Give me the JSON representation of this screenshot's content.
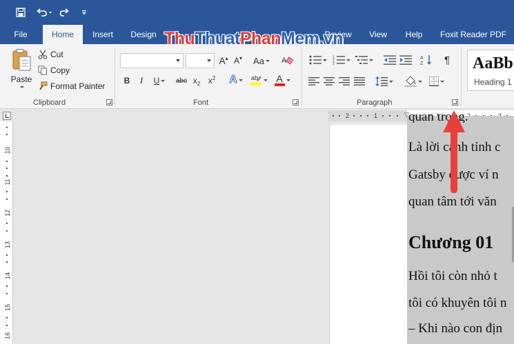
{
  "tabs": [
    {
      "label": "File"
    },
    {
      "label": "Home"
    },
    {
      "label": "Insert"
    },
    {
      "label": "Design"
    },
    {
      "label": "Review"
    },
    {
      "label": "View"
    },
    {
      "label": "Help"
    },
    {
      "label": "Foxit Reader PDF"
    }
  ],
  "watermark": {
    "part1": "Thu",
    "part2": "Thuat",
    "part3": "Phan",
    "part4": "Mem.vn"
  },
  "clipboard": {
    "paste_label": "Paste",
    "cut_label": "Cut",
    "copy_label": "Copy",
    "format_painter_label": "Format Painter",
    "group_label": "Clipboard"
  },
  "font": {
    "font_name": "",
    "font_size": "",
    "change_case": "Aa",
    "bold": "B",
    "italic": "I",
    "underline": "U",
    "strikethrough": "abc",
    "subscript": "x",
    "subscript_mark": "2",
    "superscript": "x",
    "superscript_mark": "2",
    "text_effect": "A",
    "font_color": "A",
    "grow": "A",
    "shrink": "A",
    "group_label": "Font"
  },
  "paragraph": {
    "group_label": "Paragraph"
  },
  "styles": {
    "sample": "AaBb",
    "name": "Heading 1"
  },
  "ruler": {
    "h_numbers": [
      "2",
      "1",
      "1",
      "2",
      "3"
    ],
    "v_numbers": [
      "10",
      "11",
      "12",
      "13",
      "14",
      "15",
      "16"
    ]
  },
  "document": {
    "lines": [
      "Là lời cảnh tỉnh c",
      "Gatsby được ví n",
      "quan tâm tới văn"
    ],
    "heading": "Chương 01",
    "lines2": [
      "Hồi tôi còn nhỏ t",
      "tôi có khuyên tôi n",
      "– Khi nào con địn"
    ],
    "top_cut": "quan trọng."
  },
  "colors": {
    "title_blue": "#2b579a",
    "ribbon_bg": "#f3f3f3",
    "annotation_red": "#e8413c",
    "highlight_yellow": "#ffff00",
    "font_color_red": "#e8211f"
  }
}
